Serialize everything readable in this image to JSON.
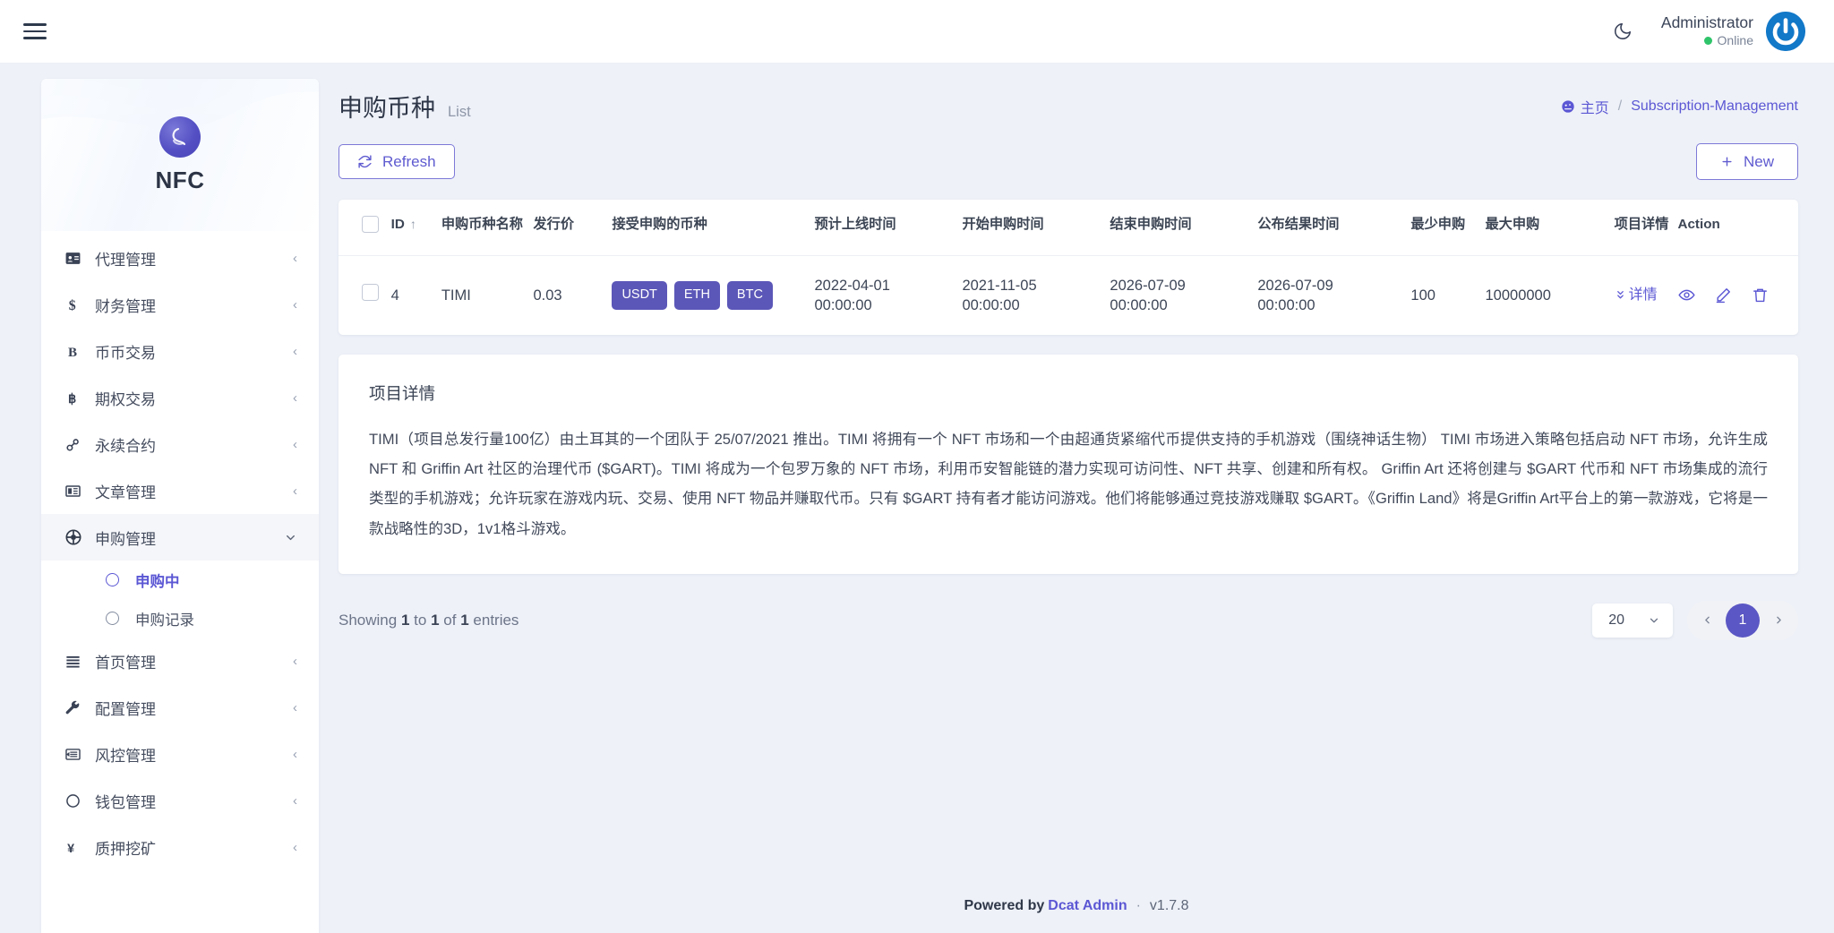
{
  "topbar": {
    "menu_icon": "hamburger-icon",
    "theme_icon": "moon-icon",
    "user_name": "Administrator",
    "user_status": "Online",
    "avatar_icon": "power-avatar-icon"
  },
  "sidebar": {
    "brand": "NFC",
    "items": [
      {
        "label": "代理管理",
        "icon": "id-card-icon",
        "chevron": "‹",
        "expanded": false
      },
      {
        "label": "财务管理",
        "icon": "dollar-icon",
        "chevron": "‹",
        "expanded": false
      },
      {
        "label": "币币交易",
        "icon": "bold-b-icon",
        "chevron": "‹",
        "expanded": false
      },
      {
        "label": "期权交易",
        "icon": "bitcoin-icon",
        "chevron": "‹",
        "expanded": false
      },
      {
        "label": "永续合约",
        "icon": "link-chain-icon",
        "chevron": "‹",
        "expanded": false
      },
      {
        "label": "文章管理",
        "icon": "newspaper-icon",
        "chevron": "‹",
        "expanded": false
      },
      {
        "label": "申购管理",
        "icon": "lifebuoy-icon",
        "chevron": "⌄",
        "expanded": true
      },
      {
        "label": "首页管理",
        "icon": "list-lines-icon",
        "chevron": "‹",
        "expanded": false
      },
      {
        "label": "配置管理",
        "icon": "wrench-icon",
        "chevron": "‹",
        "expanded": false
      },
      {
        "label": "风控管理",
        "icon": "indent-icon",
        "chevron": "‹",
        "expanded": false
      },
      {
        "label": "钱包管理",
        "icon": "circle-icon",
        "chevron": "‹",
        "expanded": false
      },
      {
        "label": "质押挖矿",
        "icon": "yen-icon",
        "chevron": "‹",
        "expanded": false
      }
    ],
    "submenu": [
      {
        "label": "申购中",
        "active": true
      },
      {
        "label": "申购记录",
        "active": false
      }
    ]
  },
  "page": {
    "title": "申购币种",
    "subtitle": "List",
    "breadcrumb": {
      "home_icon": "dashboard-icon",
      "home": "主页",
      "separator": "/",
      "current": "Subscription-Management"
    }
  },
  "toolbar": {
    "refresh_label": "Refresh",
    "refresh_icon": "refresh-icon",
    "new_label": "New",
    "new_icon": "plus-icon"
  },
  "table": {
    "columns": [
      "ID",
      "申购币种名称",
      "发行价",
      "接受申购的币种",
      "预计上线时间",
      "开始申购时间",
      "结束申购时间",
      "公布结果时间",
      "最少申购",
      "最大申购",
      "项目详情",
      "Action"
    ],
    "sort_indicator": "↑",
    "rows": [
      {
        "id": "4",
        "coin_name": "TIMI",
        "issue_price": "0.03",
        "accepted_coins": [
          "USDT",
          "ETH",
          "BTC"
        ],
        "expected_online": "2022-04-01 00:00:00",
        "start_time": "2021-11-05 00:00:00",
        "end_time": "2026-07-09 00:00:00",
        "result_time": "2026-07-09 00:00:00",
        "min_subscription": "100",
        "max_subscription": "10000000",
        "detail_toggle_label": "详情",
        "detail_toggle_icon": "chevrons-down-icon",
        "actions": [
          "eye-icon",
          "pencil-icon",
          "trash-icon"
        ]
      }
    ]
  },
  "detail_panel": {
    "title": "项目详情",
    "body": "TIMI（项目总发行量100亿）由土耳其的一个团队于 25/07/2021 推出。TIMI 将拥有一个 NFT 市场和一个由超通货紧缩代币提供支持的手机游戏（围绕神话生物） TIMI 市场进入策略包括启动 NFT 市场，允许生成 NFT 和 Griffin Art 社区的治理代币 ($GART)。TIMI 将成为一个包罗万象的 NFT 市场，利用币安智能链的潜力实现可访问性、NFT 共享、创建和所有权。 Griffin Art 还将创建与 $GART 代币和 NFT 市场集成的流行类型的手机游戏；允许玩家在游戏内玩、交易、使用 NFT 物品并赚取代币。只有 $GART 持有者才能访问游戏。他们将能够通过竞技游戏赚取 $GART。《Griffin Land》将是Griffin Art平台上的第一款游戏，它将是一款战略性的3D，1v1格斗游戏。"
  },
  "pagination": {
    "showing_prefix": "Showing",
    "from": "1",
    "to_word": "to",
    "to": "1",
    "of_word": "of",
    "total": "1",
    "entries_word": "entries",
    "page_size": "20",
    "prev_icon": "chevron-left-icon",
    "next_icon": "chevron-right-icon",
    "current_page": "1"
  },
  "footer": {
    "powered": "Powered by",
    "brand": "Dcat Admin",
    "sep": "·",
    "version": "v1.7.8"
  },
  "colors": {
    "accent": "#5b57d4",
    "badge": "#5b57b8",
    "online": "#2fc46a",
    "page_bg": "#eef1f8"
  }
}
